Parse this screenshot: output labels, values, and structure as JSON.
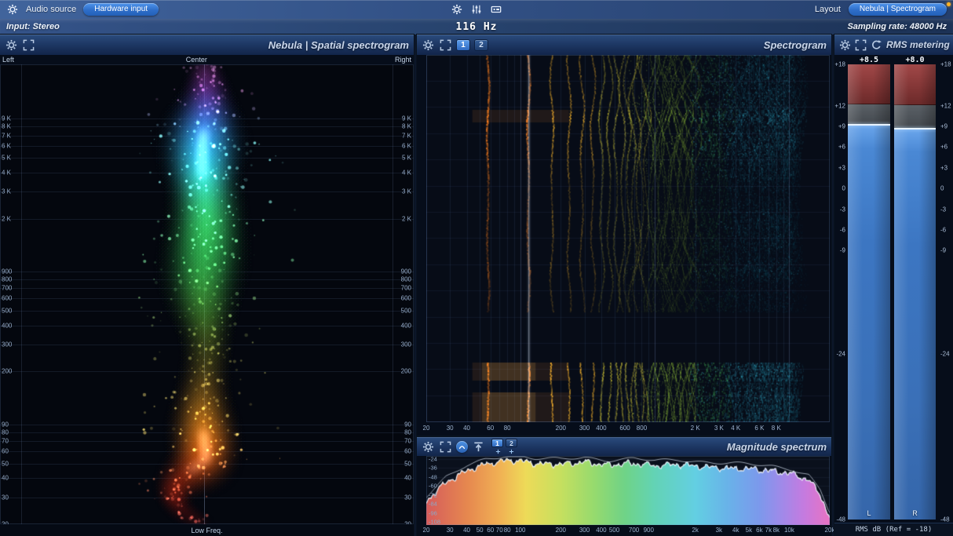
{
  "topbar": {
    "audio_source": "Audio source",
    "hardware_input": "Hardware input",
    "freq_readout": "116 Hz",
    "layout": "Layout",
    "layout_preset": "Nebula | Spectrogram",
    "input_info": "Input: Stereo",
    "sampling_rate": "Sampling rate: 48000 Hz"
  },
  "icons": {
    "settings": "gear",
    "fullscreen": "expand-corners",
    "reset": "circular-arrow",
    "channels": "sliders",
    "io_meter": "io-box",
    "peak_toggle": "circle-curve",
    "reset_peaks": "arrow-to-top",
    "add": "plus"
  },
  "spatial": {
    "title": "Nebula | Spatial spectrogram",
    "left_label": "Left",
    "center_label": "Center",
    "right_label": "Right",
    "bottom_label": "Low Freq.",
    "ticks": [
      {
        "f": 9000,
        "label": "9 K"
      },
      {
        "f": 8000,
        "label": "8 K"
      },
      {
        "f": 7000,
        "label": "7 K"
      },
      {
        "f": 6000,
        "label": "6 K"
      },
      {
        "f": 5000,
        "label": "5 K"
      },
      {
        "f": 4000,
        "label": "4 K"
      },
      {
        "f": 3000,
        "label": "3 K"
      },
      {
        "f": 2000,
        "label": "2 K"
      },
      {
        "f": 900,
        "label": "900"
      },
      {
        "f": 800,
        "label": "800"
      },
      {
        "f": 700,
        "label": "700"
      },
      {
        "f": 600,
        "label": "600"
      },
      {
        "f": 500,
        "label": "500"
      },
      {
        "f": 400,
        "label": "400"
      },
      {
        "f": 300,
        "label": "300"
      },
      {
        "f": 200,
        "label": "200"
      },
      {
        "f": 90,
        "label": "90"
      },
      {
        "f": 80,
        "label": "80"
      },
      {
        "f": 70,
        "label": "70"
      },
      {
        "f": 60,
        "label": "60"
      },
      {
        "f": 50,
        "label": "50"
      },
      {
        "f": 40,
        "label": "40"
      },
      {
        "f": 30,
        "label": "30"
      },
      {
        "f": 20,
        "label": "20"
      }
    ]
  },
  "spectrogram": {
    "title": "Spectrogram",
    "view_buttons": [
      "1",
      "2"
    ],
    "cursor_freq_hz": 116,
    "x_ticks": [
      {
        "f": 20,
        "label": "20"
      },
      {
        "f": 30,
        "label": "30"
      },
      {
        "f": 40,
        "label": "40"
      },
      {
        "f": 60,
        "label": "60"
      },
      {
        "f": 80,
        "label": "80"
      },
      {
        "f": 200,
        "label": "200"
      },
      {
        "f": 300,
        "label": "300"
      },
      {
        "f": 400,
        "label": "400"
      },
      {
        "f": 600,
        "label": "600"
      },
      {
        "f": 800,
        "label": "800"
      },
      {
        "f": 2000,
        "label": "2 K"
      },
      {
        "f": 3000,
        "label": "3 K"
      },
      {
        "f": 4000,
        "label": "4 K"
      },
      {
        "f": 6000,
        "label": "6 K"
      },
      {
        "f": 8000,
        "label": "8 K"
      }
    ]
  },
  "magnitude": {
    "title": "Magnitude spectrum",
    "view_buttons": [
      "1",
      "2"
    ],
    "y_ticks": [
      {
        "v": -24,
        "label": "-24"
      },
      {
        "v": -36,
        "label": "-36"
      },
      {
        "v": -48,
        "label": "-48"
      },
      {
        "v": -60,
        "label": "-60"
      },
      {
        "v": -72,
        "label": "-72"
      },
      {
        "v": -84,
        "label": "-84"
      },
      {
        "v": -96,
        "label": "-96"
      },
      {
        "v": -108,
        "label": "-108"
      }
    ],
    "x_ticks": [
      {
        "f": 20,
        "label": "20"
      },
      {
        "f": 30,
        "label": "30"
      },
      {
        "f": 40,
        "label": "40"
      },
      {
        "f": 50,
        "label": "50"
      },
      {
        "f": 60,
        "label": "60"
      },
      {
        "f": 70,
        "label": "70"
      },
      {
        "f": 80,
        "label": "80"
      },
      {
        "f": 100,
        "label": "100"
      },
      {
        "f": 200,
        "label": "200"
      },
      {
        "f": 300,
        "label": "300"
      },
      {
        "f": 400,
        "label": "400"
      },
      {
        "f": 500,
        "label": "500"
      },
      {
        "f": 700,
        "label": "700"
      },
      {
        "f": 900,
        "label": "900"
      },
      {
        "f": 2000,
        "label": "2k"
      },
      {
        "f": 3000,
        "label": "3k"
      },
      {
        "f": 4000,
        "label": "4k"
      },
      {
        "f": 5000,
        "label": "5k"
      },
      {
        "f": 6000,
        "label": "6k"
      },
      {
        "f": 7000,
        "label": "7k"
      },
      {
        "f": 8000,
        "label": "8k"
      },
      {
        "f": 10000,
        "label": "10k"
      },
      {
        "f": 20000,
        "label": "20k"
      }
    ]
  },
  "rms": {
    "title": "RMS metering",
    "footer": "RMS dB (Ref = -18)",
    "scale_ticks": [
      {
        "v": 18,
        "label": "+18"
      },
      {
        "v": 12,
        "label": "+12"
      },
      {
        "v": 9,
        "label": "+9"
      },
      {
        "v": 6,
        "label": "+6"
      },
      {
        "v": 3,
        "label": "+3"
      },
      {
        "v": 0,
        "label": "0"
      },
      {
        "v": -3,
        "label": "-3"
      },
      {
        "v": -6,
        "label": "-6"
      },
      {
        "v": -9,
        "label": "-9"
      },
      {
        "v": -24,
        "label": "-24"
      },
      {
        "v": -48,
        "label": "-48"
      }
    ],
    "meters": [
      {
        "channel": "L",
        "value_label": "+8.5",
        "value": 8.5,
        "red_to": 12.2,
        "gray_to": 9.2
      },
      {
        "channel": "R",
        "value_label": "+8.0",
        "value": 8.0,
        "red_to": 12.1,
        "gray_to": 8.7
      }
    ]
  }
}
